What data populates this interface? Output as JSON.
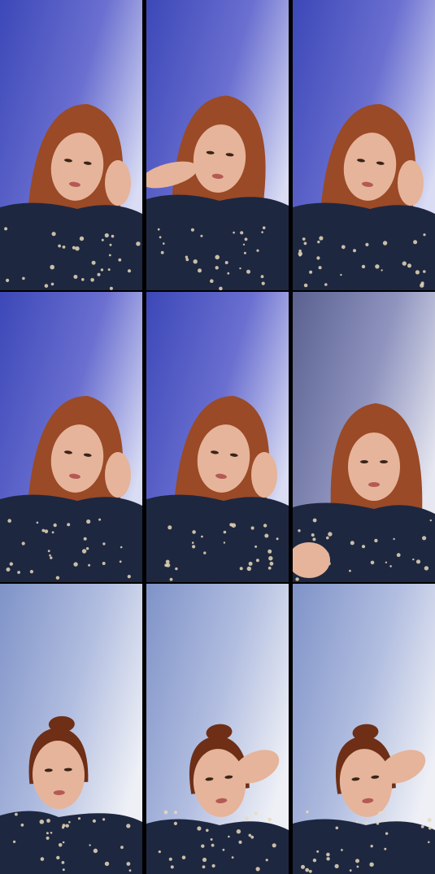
{
  "grid": {
    "rows": 3,
    "columns": 3
  },
  "frames": [
    {
      "id": 1,
      "background": "blue-wall",
      "hair": "down",
      "pose": "head-rest"
    },
    {
      "id": 2,
      "background": "blue-wall",
      "hair": "down",
      "pose": "hand-face"
    },
    {
      "id": 3,
      "background": "blue-wall",
      "hair": "down",
      "pose": "head-rest"
    },
    {
      "id": 4,
      "background": "blue-wall",
      "hair": "down",
      "pose": "head-rest"
    },
    {
      "id": 5,
      "background": "blue-wall",
      "hair": "down",
      "pose": "head-rest"
    },
    {
      "id": 6,
      "background": "grey-wall",
      "hair": "down",
      "pose": "hand-low"
    },
    {
      "id": 7,
      "background": "pale-wall",
      "hair": "bun",
      "pose": "neutral"
    },
    {
      "id": 8,
      "background": "pale-wall",
      "hair": "bun",
      "pose": "hand-forehead"
    },
    {
      "id": 9,
      "background": "pale-wall",
      "hair": "bun",
      "pose": "hand-forehead"
    }
  ],
  "colors": {
    "hair": "#9a4a26",
    "hairDark": "#6e2f16",
    "skin": "#e6b49a",
    "shirt": "#1e2740",
    "stars": "#e8d9b8"
  }
}
